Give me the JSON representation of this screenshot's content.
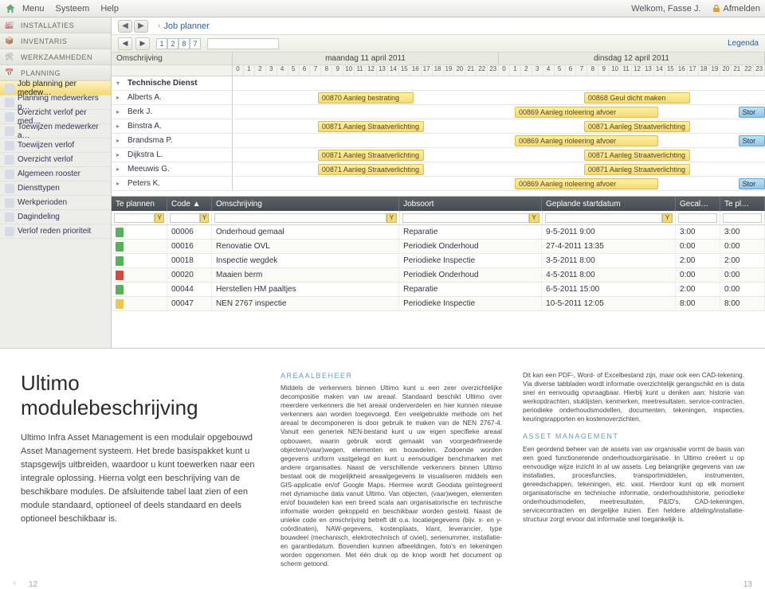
{
  "topbar": {
    "menu": [
      "Menu",
      "Systeem",
      "Help"
    ],
    "welcome": "Welkom, Fasse J.",
    "logout": "Afmelden"
  },
  "sidebar": {
    "sections": [
      {
        "label": "INSTALLATIES"
      },
      {
        "label": "INVENTARIS"
      },
      {
        "label": "WERKZAAMHEDEN"
      },
      {
        "label": "PLANNING"
      }
    ],
    "items": [
      "Job planning per medew…",
      "Planning medewerkers p…",
      "Overzicht verlof per med…",
      "Toewijzen medewerker a…",
      "Toewijzen verlof",
      "Overzicht verlof",
      "Algemeen rooster",
      "Diensttypen",
      "Werkperioden",
      "Dagindeling",
      "Verlof reden prioriteit"
    ]
  },
  "breadcrumb": {
    "title": "Job planner"
  },
  "pager": [
    "1",
    "2",
    "8",
    "7"
  ],
  "legenda": "Legenda",
  "timeline": {
    "descLabel": "Omschrijving",
    "days": [
      "maandag 11 april 2011",
      "dinsdag 12 april 2011"
    ],
    "group": "Technische Dienst",
    "people": [
      "Alberts A.",
      "Berk J.",
      "Binstra A.",
      "Brandsma P.",
      "Dijkstra L.",
      "Meeuwis G.",
      "Peters K."
    ],
    "bars": {
      "b1": "00870  Aanleg bestrating",
      "b2": "00871  Aanleg Straatverlichting",
      "b3": "00869  Aanleg rioleering afvoer",
      "b4": "00868  Geul dicht maken",
      "b5": "Stor"
    }
  },
  "grid": {
    "headers": {
      "st": "Te plannen",
      "code": "Code",
      "desc": "Omschrijving",
      "job": "Jobsoort",
      "date": "Geplande startdatum",
      "g1": "Gecal…",
      "g2": "Te pl…"
    },
    "rows": [
      {
        "flag": "green",
        "code": "00006",
        "desc": "Onderhoud gemaal",
        "job": "Reparatie",
        "date": "9-5-2011 9:00",
        "g1": "3:00",
        "g2": "3:00"
      },
      {
        "flag": "green",
        "code": "00016",
        "desc": "Renovatie OVL",
        "job": "Periodiek Onderhoud",
        "date": "27-4-2011 13:35",
        "g1": "0:00",
        "g2": "0:00"
      },
      {
        "flag": "green",
        "code": "00018",
        "desc": "Inspectie wegdek",
        "job": "Periodieke Inspectie",
        "date": "3-5-2011 8:00",
        "g1": "2:00",
        "g2": "2:00"
      },
      {
        "flag": "red",
        "code": "00020",
        "desc": "Maaien berm",
        "job": "Periodiek Onderhoud",
        "date": "4-5-2011 8:00",
        "g1": "0:00",
        "g2": "0:00"
      },
      {
        "flag": "green",
        "code": "00044",
        "desc": "Herstellen HM paaltjes",
        "job": "Reparatie",
        "date": "6-5-2011 15:00",
        "g1": "2:00",
        "g2": "0:00"
      },
      {
        "flag": "yellow",
        "code": "00047",
        "desc": "NEN 2767 inspectie",
        "job": "Periodieke Inspectie",
        "date": "10-5-2011 12:05",
        "g1": "8:00",
        "g2": "8:00"
      }
    ]
  },
  "article": {
    "title": "Ultimo modulebeschrijving",
    "lead": "Ultimo Infra Asset Management is een modulair opgebouwd Asset Management systeem. Het brede basispakket kunt u stapsgewijs uitbreiden, waardoor u kunt toewerken naar een integrale oplossing. Hierna volgt een beschrijving van de beschikbare modules. De afsluitende tabel laat zien of een module standaard, optioneel of deels standaard en deels optioneel beschikbaar is.",
    "mid_title": "AREAALBEHEER",
    "mid_body": "Middels de verkenners binnen Ultimo kunt u een zeer overzichtelijke decompositie maken van uw areaal. Standaard beschikt Ultimo over meerdere verkenners die het areaal onderverdelen en hier kunnen nieuwe verkenners aan worden toegevoegd. Een veelgebruikte methode om het areaal te decomponeren is door gebruik te maken van de NEN 2767-4. Vanuit een generiek NEN-bestand kunt u uw eigen specifieke areaal opbouwen, waarin gebruik wordt gemaakt van voorgedefinieerde objecten/(vaar)wegen, elementen en bouwdelen. Zodoende worden gegevens uniform vastgelegd en kunt u eenvoudiger benchmarken met andere organisaties. Naast de verschillende verkenners binnen Ultimo bestaat ook de mogelijkheid areaalgegevens te visualiseren middels een GIS-applicatie en/of Google Maps. Hiermee wordt Geodata geïntegreerd met dynamische data vanuit Ultimo. Van objecten, (vaar)wegen, elementen en/of bouwdelen kan een breed scala aan organisatorische en technische informatie worden gekoppeld en beschikbaar worden gesteld. Naast de unieke code en omschrijving betreft dit o.a. locatiegegevens (bijv. x- en y-coördinaten), NAW-gegevens, kostenplaats, klant, leverancier, type bouwdeel (mechanisch, elektrotechnisch of civiel), serienummer, installatie- en garantiedatum. Bovendien kunnen afbeeldingen, foto's en tekeningen worden opgenomen. Met één druk op de knop wordt het document op scherm getoond.",
    "right_p1": "Dit kan een PDF-, Word- of Excelbestand zijn, maar ook een CAD-tekening. Via diverse tabbladen wordt informatie overzichtelijk gerangschikt en is data snel en eenvoudig opvraagbaar. Hierbij kunt u denken aan: historie van werkopdrachten, stuklijsten, kenmerken, meetresultaten, service-contracten, periodieke onderhoudsmodellen, documenten, tekeningen, inspecties, keuringsrapporten en kostenoverzichten.",
    "right_title": "ASSET MANAGEMENT",
    "right_p2": "Een geordend beheer van de assets van uw organisatie vormt de basis van een goed functionerende onderhoudsorganisatie. In Ultimo creëert u op eenvoudige wijze inzicht in al uw assets. Leg belangrijke gegevens van uw installaties, procesfuncties, transportmiddelen, instrumenten, gereedschappen, tekeningen, etc. vast. Hierdoor kunt op elk moment organisatorische en technische informatie, onderhoudshistorie, periodieke onderhoudsmodellen, meetresultaten, P&ID's, CAD-tekeningen, servicecontracten en dergelijke inzien. Een heldere afdeling/installatie-structuur zorgt ervoor dat informatie snel toegankelijk is.",
    "page_left": "12",
    "page_right": "13"
  }
}
